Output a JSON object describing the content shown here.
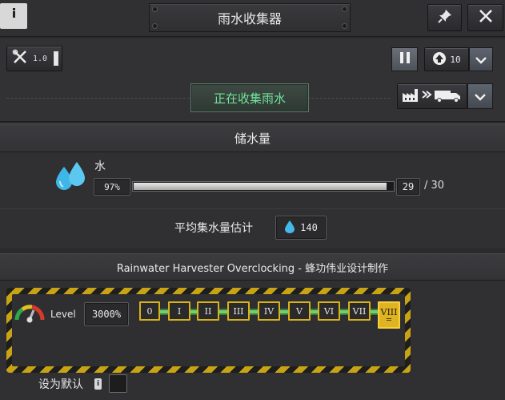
{
  "window": {
    "title": "雨水收集器",
    "icons": {
      "info": "info-icon",
      "pin": "pin-icon",
      "close": "close-icon"
    }
  },
  "controls": {
    "tool_value": "1.0",
    "priority_value": "10",
    "status_button": "正在收集雨水",
    "icons": {
      "tools": "wrench-screwdriver-icon",
      "pause": "pause-icon",
      "priority": "up-arrow-circle-icon",
      "dropdown": "chevron-down-icon",
      "output": "factory-to-truck-icon"
    }
  },
  "storage": {
    "header": "储水量",
    "resource_name": "水",
    "percent_text": "97%",
    "fill_fraction": 0.97,
    "amount": "29",
    "capacity_text": "/ 30",
    "average_label": "平均集水量估计",
    "average_value": "140",
    "icons": {
      "resource": "water-drops-icon",
      "avg": "water-drop-icon"
    }
  },
  "overclock": {
    "header": "Rainwater Harvester Overclocking - 蜂功伟业设计制作",
    "level_label": "Level",
    "level_value": "3000%",
    "levels": [
      "0",
      "I",
      "II",
      "III",
      "IV",
      "V",
      "VI",
      "VII",
      "VIII"
    ],
    "active_level": "VIII",
    "active_marker": "=",
    "default_label": "设为默认",
    "default_info": "i",
    "default_checked": false,
    "colors": {
      "hazard": "#c8a415",
      "track": "#71d06d",
      "active": "#e0b420"
    },
    "icons": {
      "gauge": "speed-gauge-icon"
    }
  }
}
